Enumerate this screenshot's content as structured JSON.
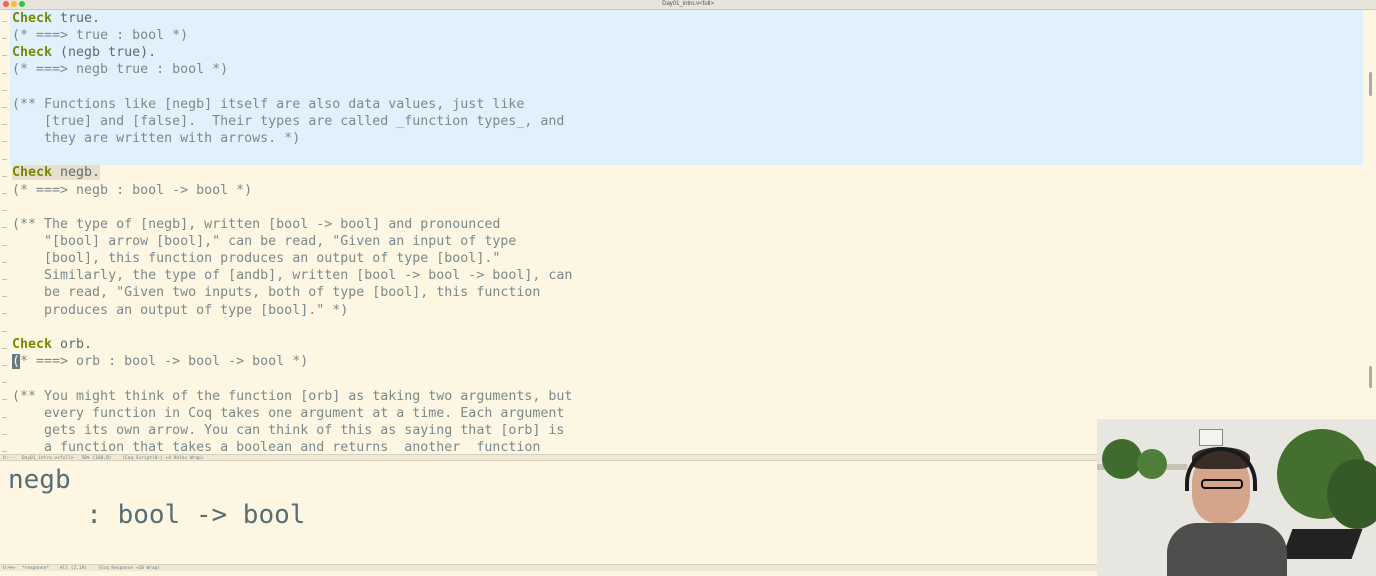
{
  "window": {
    "title": "Day01_intro.v<full>"
  },
  "editor": {
    "lines": [
      {
        "kw": "Check",
        "rest": " true."
      },
      {
        "comment": "(* ===> true : bool *)"
      },
      {
        "kw": "Check",
        "rest": " (negb true)."
      },
      {
        "comment": "(* ===> negb true : bool *)"
      },
      {
        "comment": ""
      },
      {
        "comment": "(** Functions like [negb] itself are also data values, just like"
      },
      {
        "comment": "    [true] and [false].  Their types are called _function types_, and"
      },
      {
        "comment": "    they are written with arrows. *)"
      },
      {
        "comment": ""
      },
      {
        "kw": "Check",
        "rest": " negb."
      },
      {
        "comment": "(* ===> negb : bool -> bool *)"
      },
      {
        "comment": ""
      },
      {
        "comment": "(** The type of [negb], written [bool -> bool] and pronounced"
      },
      {
        "comment": "    \"[bool] arrow [bool],\" can be read, \"Given an input of type"
      },
      {
        "comment": "    [bool], this function produces an output of type [bool].\""
      },
      {
        "comment": "    Similarly, the type of [andb], written [bool -> bool -> bool], can"
      },
      {
        "comment": "    be read, \"Given two inputs, both of type [bool], this function"
      },
      {
        "comment": "    produces an output of type [bool].\" *)"
      },
      {
        "comment": ""
      },
      {
        "kw": "Check",
        "rest": " orb."
      },
      {
        "cursor": "(",
        "comment": "* ===> orb : bool -> bool -> bool *)"
      },
      {
        "comment": ""
      },
      {
        "comment": "(** You might think of the function [orb] as taking two arguments, but"
      },
      {
        "comment": "    every function in Coq takes one argument at a time. Each argument"
      },
      {
        "comment": "    gets its own arrow. You can think of this as saying that [orb] is"
      },
      {
        "comment": "    a function that takes a boolean and returns  another  function"
      }
    ]
  },
  "modeline_top": "U:---  Day01_intro.v<full>   50% (168,0)    (Coq Script(0-) +4 Holes Wrap)",
  "response": {
    "name": "negb",
    "type": "     : bool -> bool"
  },
  "modeline_bottom": "U:%%-  *response*    All (2,19)    (Coq Response +10 Wrap)"
}
